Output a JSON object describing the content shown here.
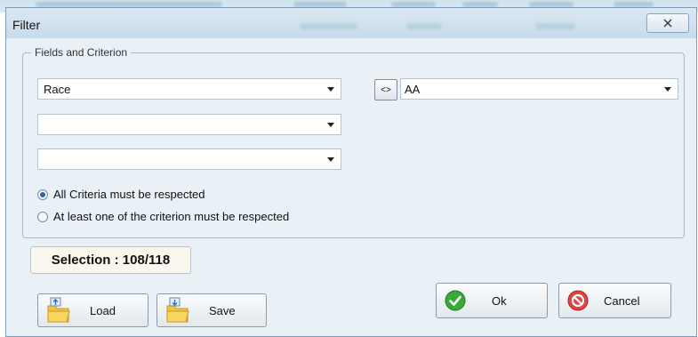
{
  "dialog": {
    "title": "Filter"
  },
  "fields_group": {
    "legend": "Fields and Criterion",
    "field_1": "Race",
    "field_2": "",
    "field_3": "",
    "operator_label": "<>",
    "value_1": "AA"
  },
  "match_mode": {
    "options": [
      {
        "label": "All Criteria must be respected",
        "selected": true
      },
      {
        "label": "At least one of the criterion must be respected",
        "selected": false
      }
    ]
  },
  "selection_text": "Selection : 108/118",
  "buttons": {
    "load": "Load",
    "save": "Save",
    "ok": "Ok",
    "cancel": "Cancel"
  },
  "icons": {
    "close": "close-icon",
    "load": "folder-load-icon",
    "save": "folder-save-icon",
    "ok": "check-icon",
    "cancel": "cancel-icon"
  }
}
